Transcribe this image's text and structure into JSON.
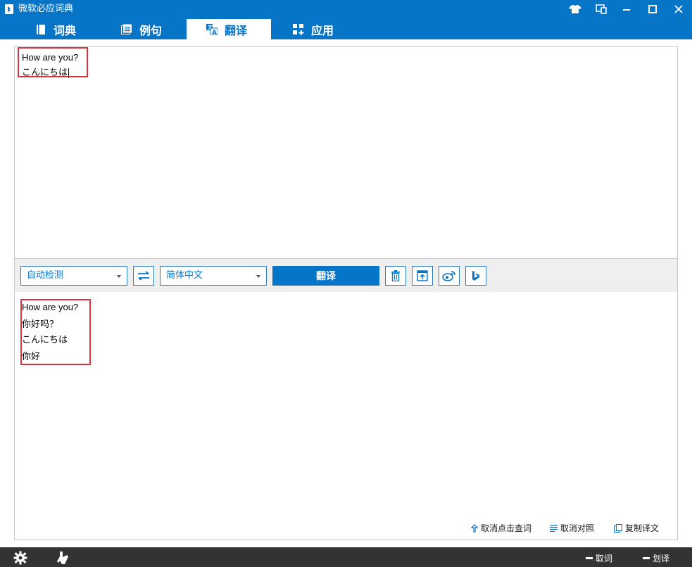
{
  "window": {
    "title": "微软必应词典",
    "buttons": [
      "skin-icon",
      "mini-mode-icon",
      "minimize-icon",
      "maximize-icon",
      "close-icon"
    ]
  },
  "tabs": [
    {
      "label": "词典",
      "icon": "book-icon",
      "active": false
    },
    {
      "label": "例句",
      "icon": "sentences-icon",
      "active": false
    },
    {
      "label": "翻译",
      "icon": "translate-icon",
      "active": true
    },
    {
      "label": "应用",
      "icon": "apps-icon",
      "active": false
    }
  ],
  "source": {
    "lines": [
      "How are you?",
      "こんにちは"
    ]
  },
  "toolbar": {
    "from_lang": "自动检测",
    "to_lang": "简体中文",
    "translate_label": "翻译",
    "icons": [
      "swap-icon",
      "trash-icon",
      "export-icon",
      "weibo-icon",
      "bing-icon"
    ]
  },
  "result": {
    "lines": [
      "How are you?",
      "你好吗？",
      "こんにちは",
      "你好"
    ],
    "actions": [
      {
        "label": "取消点击查词",
        "icon": "up-arrow-icon"
      },
      {
        "label": "取消对照",
        "icon": "list-icon"
      },
      {
        "label": "复制译文",
        "icon": "copy-icon"
      }
    ]
  },
  "statusbar": {
    "toggles": [
      {
        "label": "取词"
      },
      {
        "label": "划译"
      }
    ]
  },
  "colors": {
    "accent": "#0675c8",
    "highlight": "#d9343b",
    "statusbar": "#333333"
  }
}
